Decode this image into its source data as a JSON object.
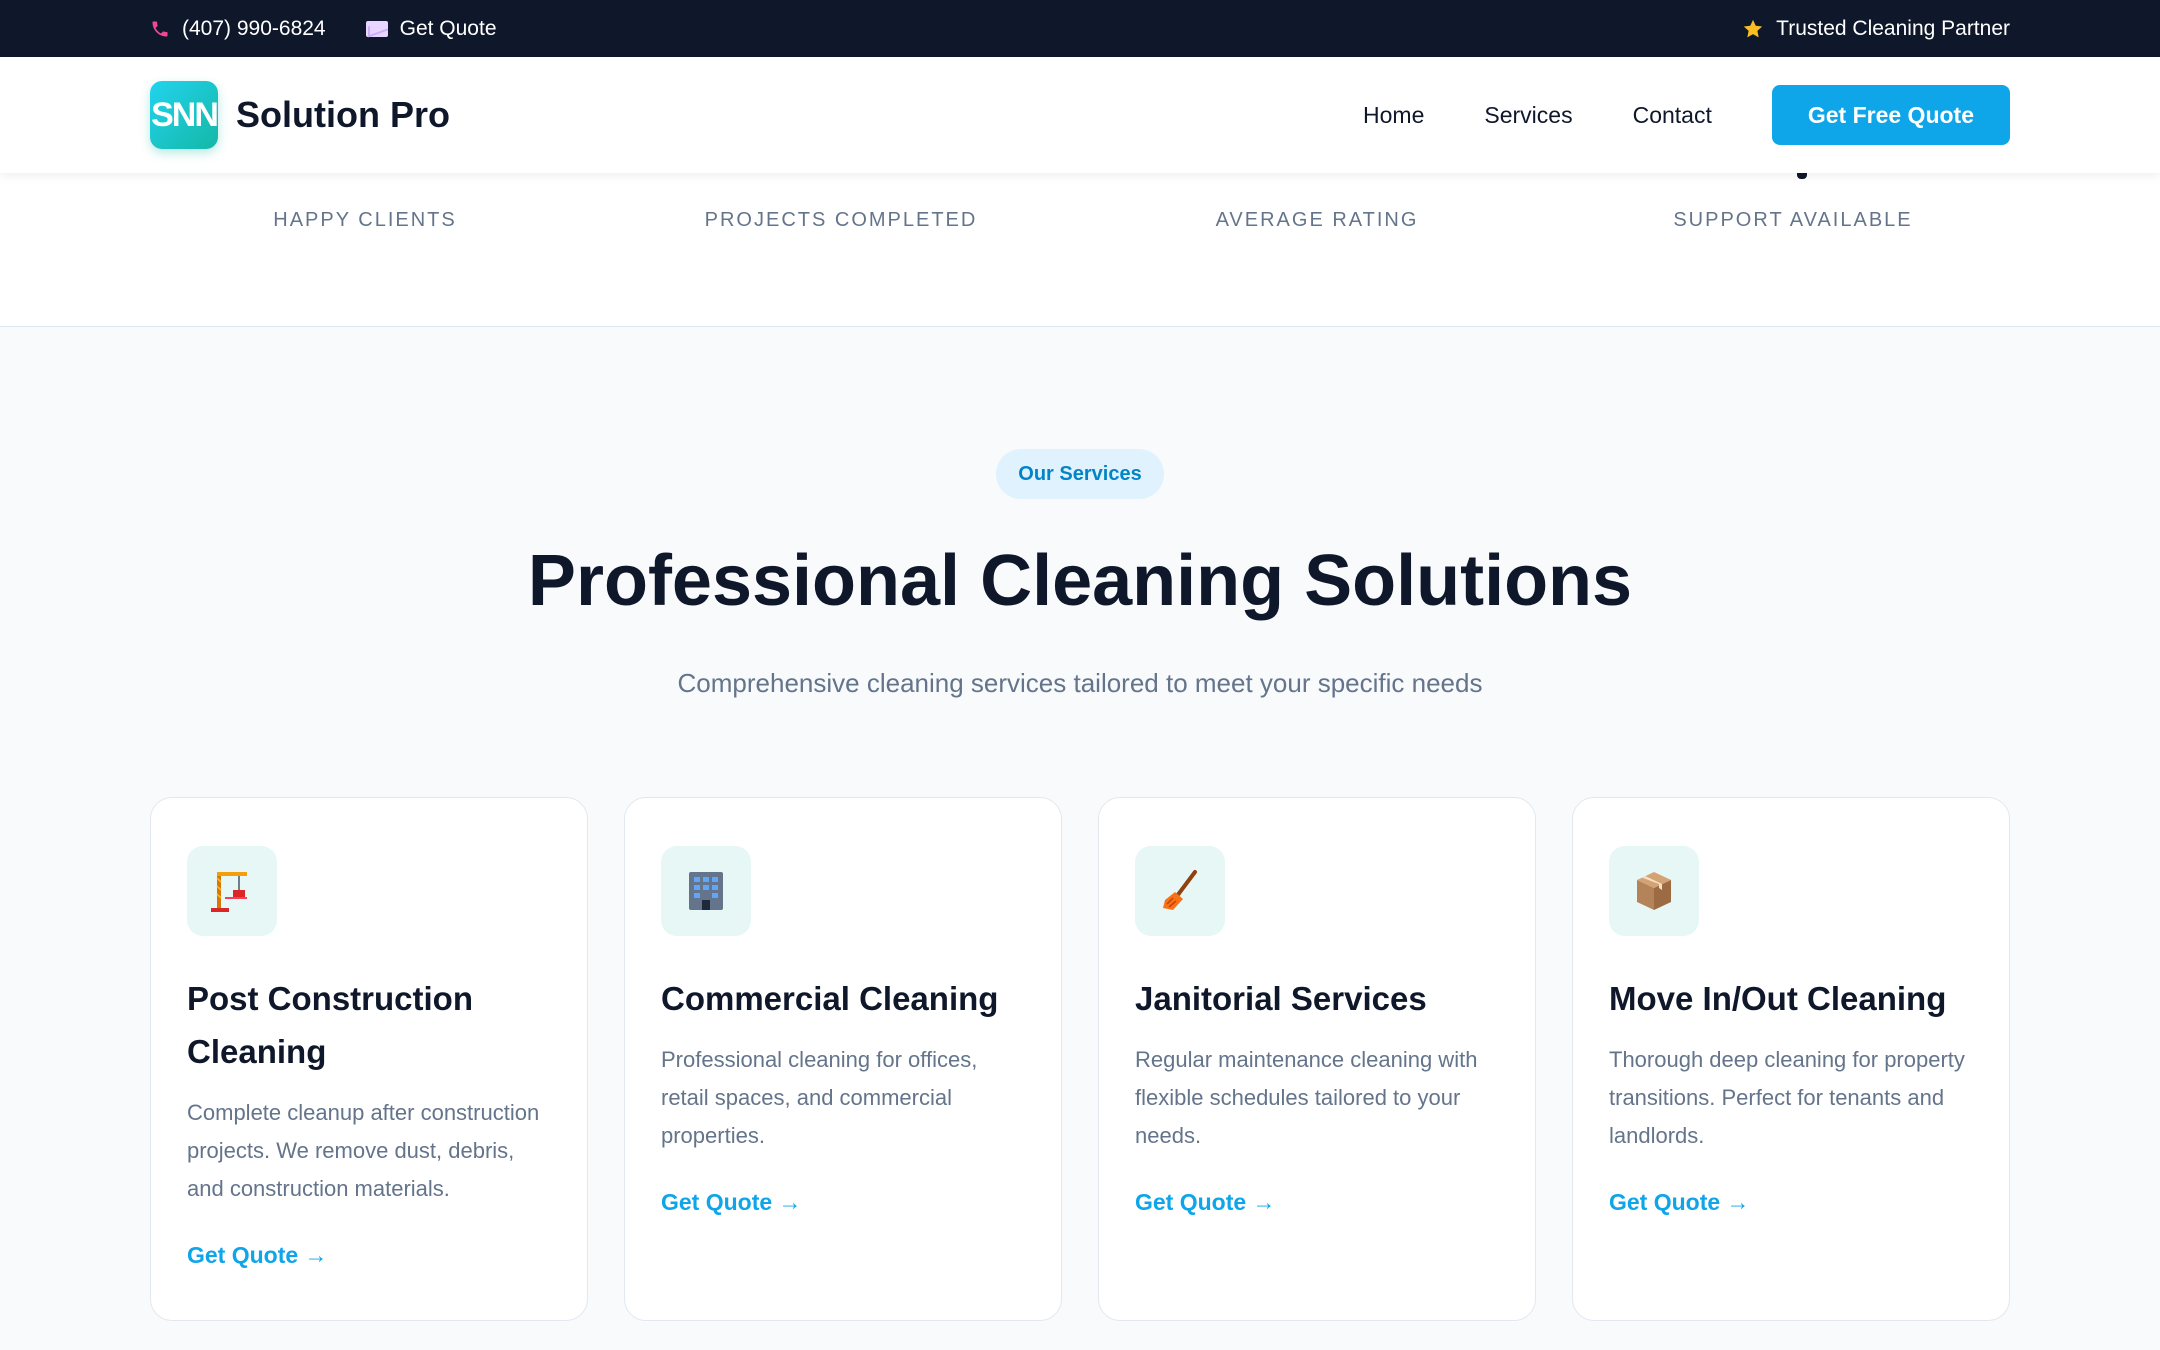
{
  "topbar": {
    "phone": "(407) 990-6824",
    "quote": "Get Quote",
    "trusted": "Trusted Cleaning Partner"
  },
  "header": {
    "logo_text": "SNN",
    "brand": "Solution Pro",
    "nav": [
      "Home",
      "Services",
      "Contact"
    ],
    "cta": "Get Free Quote"
  },
  "stats": [
    "HAPPY CLIENTS",
    "PROJECTS COMPLETED",
    "AVERAGE RATING",
    "SUPPORT AVAILABLE"
  ],
  "section": {
    "pill": "Our Services",
    "title": "Professional Cleaning Solutions",
    "subtitle": "Comprehensive cleaning services tailored to meet your specific needs"
  },
  "cards": [
    {
      "icon": "construction-crane-icon",
      "title": "Post Construction Cleaning",
      "desc": "Complete cleanup after construction projects. We remove dust, debris, and construction materials.",
      "link": "Get Quote →"
    },
    {
      "icon": "office-building-icon",
      "title": "Commercial Cleaning",
      "desc": "Professional cleaning for offices, retail spaces, and commercial properties.",
      "link": "Get Quote →"
    },
    {
      "icon": "broom-icon",
      "title": "Janitorial Services",
      "desc": "Regular maintenance cleaning with flexible schedules tailored to your needs.",
      "link": "Get Quote →"
    },
    {
      "icon": "package-box-icon",
      "title": "Move In/Out Cleaning",
      "desc": "Thorough deep cleaning for property transitions. Perfect for tenants and landlords.",
      "link": "Get Quote →"
    }
  ],
  "colors": {
    "topbar_bg": "#0f172a",
    "accent": "#0ea5e9",
    "logo_start": "#22d3ee",
    "logo_end": "#14b8a6",
    "icon_bg": "#e6f7f5"
  }
}
